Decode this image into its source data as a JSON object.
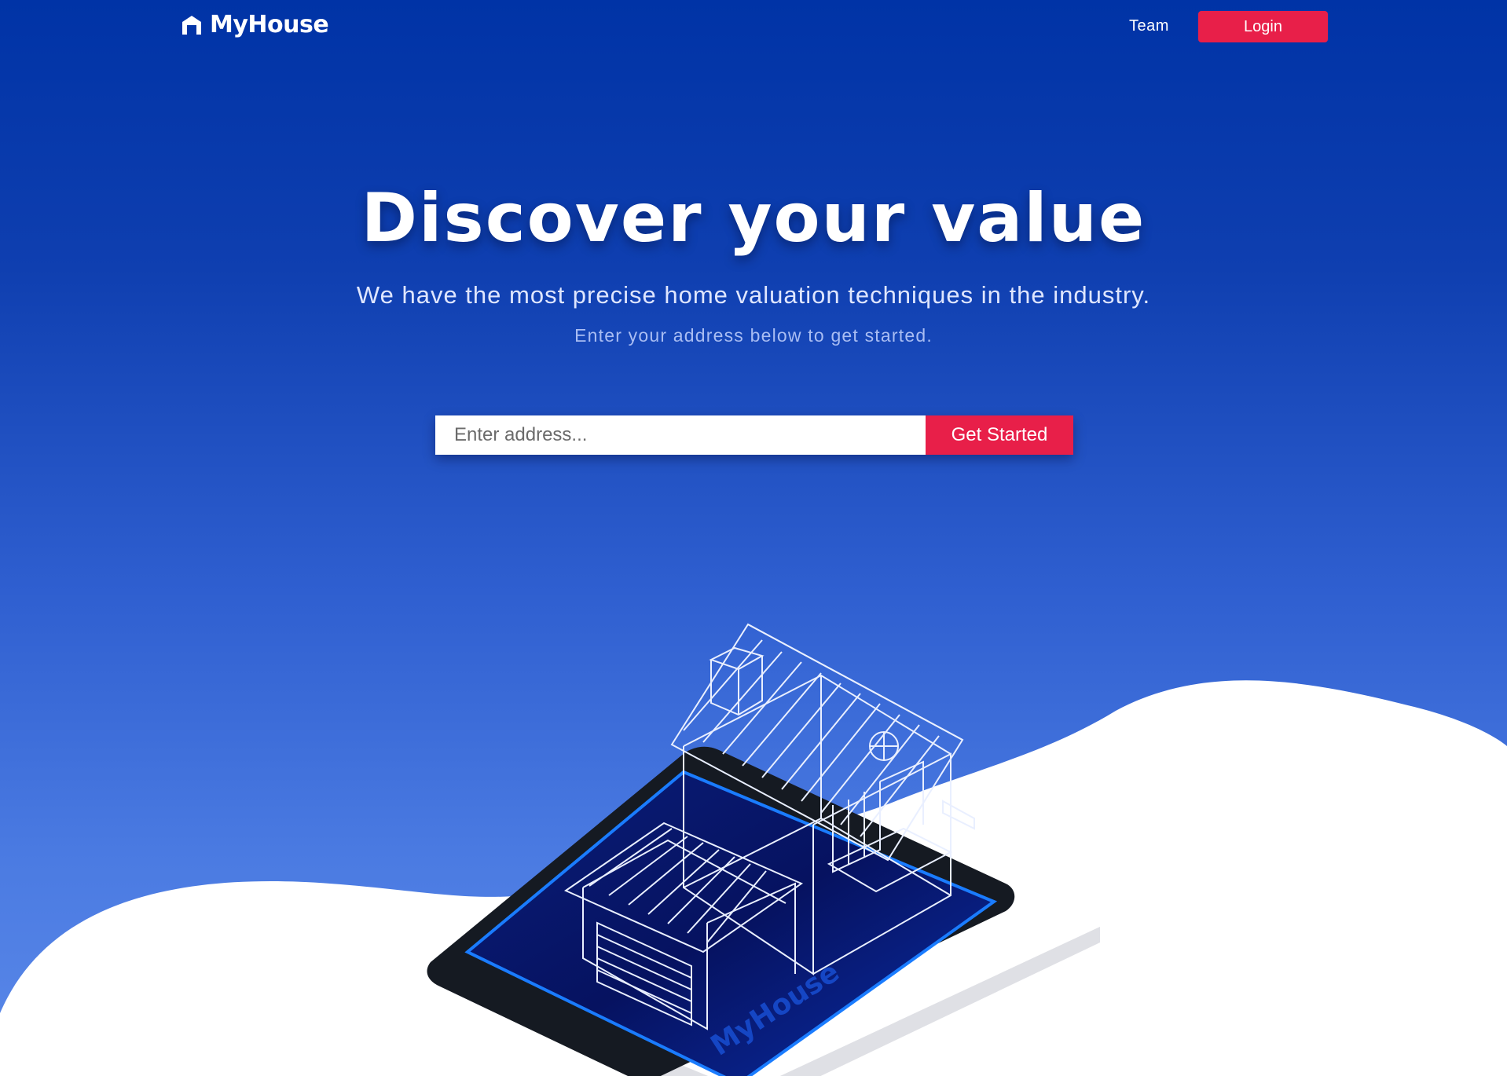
{
  "brand": {
    "name": "MyHouse",
    "icon": "house-icon"
  },
  "nav": {
    "team_label": "Team",
    "login_label": "Login"
  },
  "hero": {
    "title": "Discover your value",
    "subtitle": "We have the most precise home valuation techniques in the industry.",
    "tagline": "Enter your address below to get started."
  },
  "search": {
    "placeholder": "Enter address...",
    "value": "",
    "button_label": "Get Started"
  },
  "illustration": {
    "tablet_brand": "MyHouse"
  },
  "colors": {
    "accent": "#e81f49",
    "background_top": "#0033a6",
    "background_bottom": "#5a88e8",
    "wave": "#ffffff"
  }
}
